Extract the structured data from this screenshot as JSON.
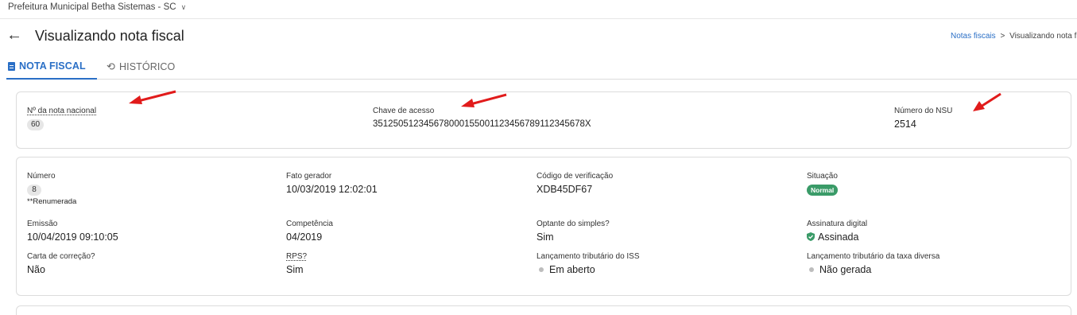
{
  "app": {
    "org_name": "Prefeitura Municipal Betha Sistemas - SC",
    "org_dropdown_icon": "chevron-down-icon"
  },
  "header": {
    "title": "Visualizando nota fiscal",
    "back_icon": "arrow-left-icon"
  },
  "breadcrumb": {
    "link": "Notas fiscais",
    "separator": ">",
    "current": "Visualizando nota f"
  },
  "tabs": [
    {
      "label": "NOTA FISCAL",
      "icon": "document-icon",
      "active": true
    },
    {
      "label": "HISTÓRICO",
      "icon": "history-icon",
      "active": false
    }
  ],
  "summary": {
    "numero_nacional": {
      "label": "Nº da nota nacional",
      "value": "60"
    },
    "chave_acesso": {
      "label": "Chave de acesso",
      "value": "35125051234567800015500112345678911234567​8X"
    },
    "nsu": {
      "label": "Número do NSU",
      "value": "2514"
    }
  },
  "details": {
    "numero": {
      "label": "Número",
      "value": "8",
      "note": "**Renumerada"
    },
    "fato_gerador": {
      "label": "Fato gerador",
      "value": "10/03/2019 12:02:01"
    },
    "codigo_verificacao": {
      "label": "Código de verificação",
      "value": "XDB45DF67"
    },
    "situacao": {
      "label": "Situação",
      "value": "Normal",
      "color": "#3a9b68"
    },
    "emissao": {
      "label": "Emissão",
      "value": "10/04/2019 09:10:05"
    },
    "competencia": {
      "label": "Competência",
      "value": "04/2019"
    },
    "optante_simples": {
      "label": "Optante do simples?",
      "value": "Sim"
    },
    "assinatura": {
      "label": "Assinatura digital",
      "value": "Assinada",
      "icon": "shield-check-icon",
      "color": "#3a9b68"
    },
    "carta_correcao": {
      "label": "Carta de correção?",
      "value": "Não"
    },
    "rps": {
      "label": "RPS?",
      "value": "Sim"
    },
    "lancamento_iss": {
      "label": "Lançamento tributário do ISS",
      "value": "Em aberto"
    },
    "lancamento_taxa": {
      "label": "Lançamento tributário da taxa diversa",
      "value": "Não gerada"
    }
  },
  "colors": {
    "accent": "#2a6fc6",
    "annotation_arrow": "#e11b1b"
  }
}
